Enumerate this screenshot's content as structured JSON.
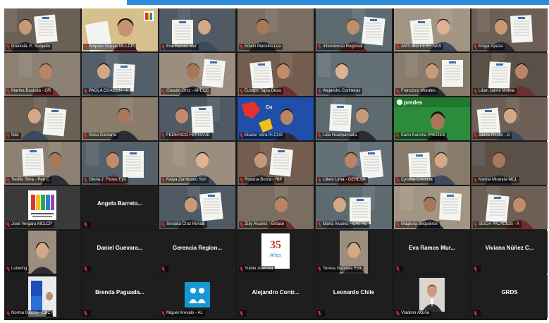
{
  "meeting": {
    "participants": [
      "Graciela. E. Salgado",
      "Amparo Vargas MCLCP",
      "Eva Ramos Mur",
      "Edwin Mansilla Lca",
      "Intendencia Regional",
      "ARTURO FERR NAS",
      "Edgar Apaza",
      "Martha Bautista - GR",
      "PAOLA CHACON - A",
      "Claudio Orcc - APECC",
      "Eulogio Tapia Deza",
      "Alejandro Contreras",
      "Francisco Morales",
      "Lilian Jaime Molina",
      "felix",
      "Rosa Gamarra",
      "FEDERICO FERNAND",
      "Eliazer Vera Ri CUS",
      "Lida Huallpamaita",
      "Karin Kancha PREDES",
      "Gloria Ovalle - D",
      "Teofilo Silva - Petr C",
      "Gloria J. Flores Eyo",
      "Katya Zambrano Sori",
      "Roxana Borca - RIP",
      "Liliam Lima - GERESA",
      "Cynthia Córdova",
      "Karina Miranda MCL",
      "José Vergara MCLCP",
      "Angela Barreto...",
      "Soraida Cruz Rimalli",
      "Zuly Alvarez - Enlace",
      "María Alvarez - GRTPE",
      "Magloria Sequeiros",
      "SEIDA PALACIOS - A",
      "Ludwing",
      "Daniel Guevara...",
      "Gerencia Region...",
      "Yulder Aramwa",
      "Teresa Gabriela Estr",
      "Eva Ramos Mur...",
      "Viviana Núñez C...",
      "Norma García - CBC",
      "Brenda Paguada...",
      "Miguel Arevalo - AL",
      "Alejandro Contr...",
      "Leonardo Chile",
      "Vladimir Acuña",
      "GRDS"
    ],
    "tile_labels": {
      "predes": "predes",
      "thirty_five": "35",
      "thirty_five_sub": "Años"
    },
    "colors": {
      "top_bar": "#2d8ad8",
      "grid_bg": "#1a1a1a",
      "active_speaker": "#e6e000",
      "muted_mic": "#e03131"
    }
  }
}
